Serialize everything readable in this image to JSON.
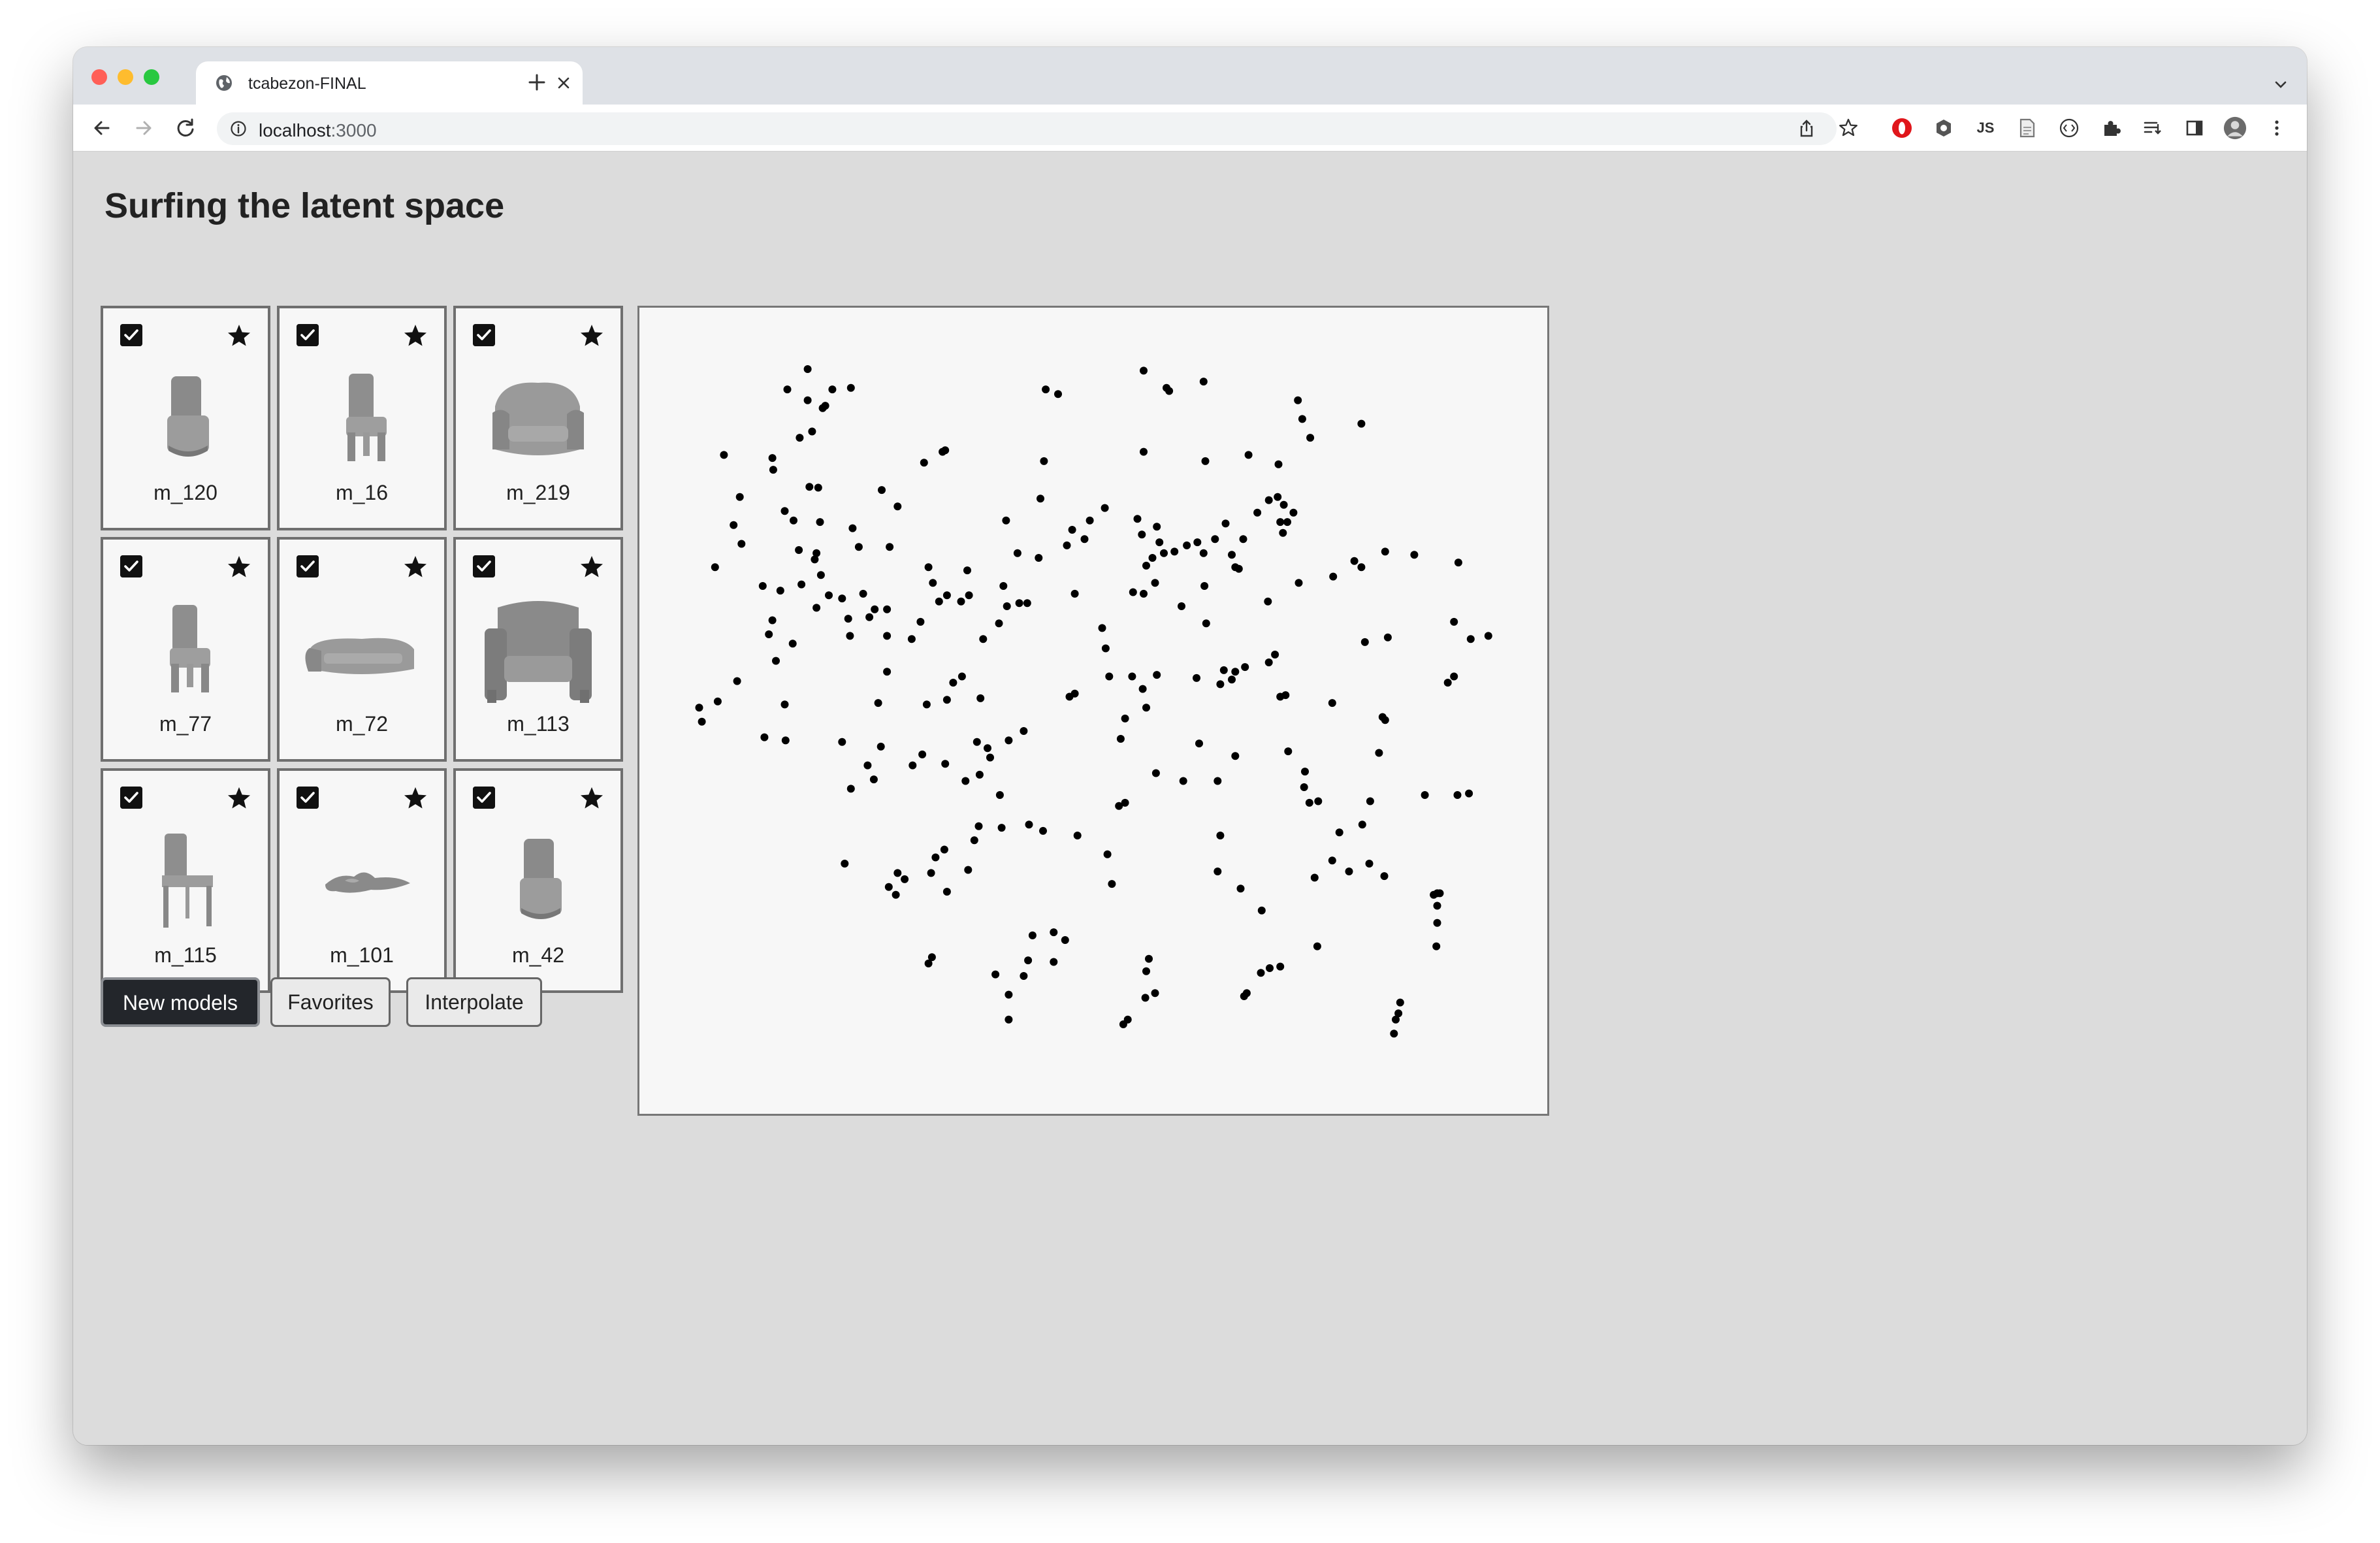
{
  "browser": {
    "tab_title": "tcabezon-FINAL",
    "url_host": "localhost",
    "url_port": ":3000",
    "traffic_colors": [
      "#ff5f57",
      "#febc2e",
      "#28c840"
    ],
    "toolbar_icons": [
      "share-icon",
      "bookmark-star-icon",
      "opera-icon",
      "shield-extension-icon",
      "js-extension-icon",
      "document-extension-icon",
      "code-extension-icon",
      "puzzle-extensions-icon",
      "reading-list-icon",
      "side-panel-icon",
      "profile-avatar",
      "more-menu-icon"
    ],
    "js_icon_text": "JS"
  },
  "page": {
    "title": "Surfing the latent space"
  },
  "models": [
    {
      "label": "m_120",
      "checked": true,
      "shape": "chair-solid"
    },
    {
      "label": "m_16",
      "checked": true,
      "shape": "chair-legs"
    },
    {
      "label": "m_219",
      "checked": true,
      "shape": "armchair-wide"
    },
    {
      "label": "m_77",
      "checked": true,
      "shape": "chair-legs"
    },
    {
      "label": "m_72",
      "checked": true,
      "shape": "sofa-low"
    },
    {
      "label": "m_113",
      "checked": true,
      "shape": "armchair-big"
    },
    {
      "label": "m_115",
      "checked": true,
      "shape": "chair-thin"
    },
    {
      "label": "m_101",
      "checked": true,
      "shape": "blob-flat"
    },
    {
      "label": "m_42",
      "checked": true,
      "shape": "chair-solid"
    }
  ],
  "buttons": {
    "new_models": "New models",
    "favorites": "Favorites",
    "interpolate": "Interpolate"
  },
  "chart_data": {
    "type": "scatter",
    "xlim": [
      0,
      100
    ],
    "ylim": [
      0,
      100
    ],
    "grid": false,
    "point_color": "#000000",
    "points": [
      [
        17.6,
        93.8
      ],
      [
        15.3,
        91.2
      ],
      [
        17.6,
        89.8
      ],
      [
        19.6,
        89.1
      ],
      [
        20.4,
        91.2
      ],
      [
        22.5,
        91.4
      ],
      [
        19.3,
        88.8
      ],
      [
        44.6,
        91.2
      ],
      [
        46.0,
        90.6
      ],
      [
        55.7,
        93.6
      ],
      [
        58.6,
        91.0
      ],
      [
        58.3,
        91.4
      ],
      [
        62.5,
        92.2
      ],
      [
        73.2,
        89.8
      ],
      [
        73.7,
        87.4
      ],
      [
        74.6,
        85.0
      ],
      [
        80.4,
        86.8
      ],
      [
        16.7,
        85.0
      ],
      [
        18.1,
        85.8
      ],
      [
        33.2,
        83.4
      ],
      [
        32.9,
        83.2
      ],
      [
        30.8,
        81.8
      ],
      [
        44.4,
        82.0
      ],
      [
        55.7,
        83.2
      ],
      [
        62.7,
        82.0
      ],
      [
        67.6,
        82.8
      ],
      [
        71.0,
        81.6
      ],
      [
        8.1,
        82.8
      ],
      [
        13.6,
        82.4
      ],
      [
        13.7,
        80.9
      ],
      [
        17.8,
        78.7
      ],
      [
        18.8,
        78.6
      ],
      [
        26.0,
        78.3
      ],
      [
        27.8,
        76.2
      ],
      [
        9.9,
        77.4
      ],
      [
        15.0,
        75.6
      ],
      [
        16.0,
        74.4
      ],
      [
        19.0,
        74.2
      ],
      [
        22.7,
        73.4
      ],
      [
        9.2,
        73.8
      ],
      [
        10.1,
        71.4
      ],
      [
        23.4,
        71.0
      ],
      [
        26.9,
        71.0
      ],
      [
        16.6,
        70.6
      ],
      [
        18.6,
        70.2
      ],
      [
        40.1,
        74.4
      ],
      [
        44.0,
        77.2
      ],
      [
        47.6,
        73.2
      ],
      [
        49.6,
        74.4
      ],
      [
        51.3,
        76.0
      ],
      [
        49.0,
        72.0
      ],
      [
        47.0,
        71.2
      ],
      [
        41.4,
        70.2
      ],
      [
        43.8,
        69.6
      ],
      [
        55.0,
        74.6
      ],
      [
        55.5,
        72.6
      ],
      [
        57.2,
        73.6
      ],
      [
        57.5,
        71.6
      ],
      [
        58.0,
        70.2
      ],
      [
        56.7,
        69.6
      ],
      [
        56.0,
        68.6
      ],
      [
        57.0,
        66.4
      ],
      [
        59.2,
        70.4
      ],
      [
        60.6,
        71.2
      ],
      [
        61.8,
        71.6
      ],
      [
        62.5,
        70.2
      ],
      [
        63.8,
        72.0
      ],
      [
        65.0,
        74.0
      ],
      [
        67.0,
        72.0
      ],
      [
        65.7,
        70.0
      ],
      [
        66.5,
        68.2
      ],
      [
        71.5,
        72.8
      ],
      [
        71.2,
        74.2
      ],
      [
        72.0,
        74.2
      ],
      [
        72.7,
        75.4
      ],
      [
        71.6,
        76.4
      ],
      [
        70.9,
        77.4
      ],
      [
        69.9,
        77.0
      ],
      [
        68.6,
        75.4
      ],
      [
        7.1,
        68.4
      ],
      [
        12.5,
        66.0
      ],
      [
        14.5,
        65.4
      ],
      [
        16.9,
        66.2
      ],
      [
        18.4,
        69.4
      ],
      [
        19.1,
        67.4
      ],
      [
        20.0,
        64.8
      ],
      [
        18.6,
        63.2
      ],
      [
        21.5,
        64.4
      ],
      [
        23.9,
        65.0
      ],
      [
        25.2,
        63.0
      ],
      [
        26.6,
        63.0
      ],
      [
        31.3,
        68.4
      ],
      [
        31.8,
        66.4
      ],
      [
        32.5,
        64.0
      ],
      [
        33.4,
        64.8
      ],
      [
        35.0,
        64.0
      ],
      [
        35.9,
        64.8
      ],
      [
        35.7,
        68.0
      ],
      [
        39.8,
        66.0
      ],
      [
        41.6,
        63.8
      ],
      [
        42.5,
        63.8
      ],
      [
        47.9,
        65.0
      ],
      [
        54.5,
        65.2
      ],
      [
        55.7,
        65.0
      ],
      [
        62.6,
        66.0
      ],
      [
        60.0,
        63.4
      ],
      [
        66.1,
        68.4
      ],
      [
        69.8,
        64.0
      ],
      [
        73.3,
        66.4
      ],
      [
        77.2,
        67.2
      ],
      [
        79.6,
        69.2
      ],
      [
        80.4,
        68.4
      ],
      [
        83.1,
        70.4
      ],
      [
        86.4,
        70.0
      ],
      [
        91.4,
        69.0
      ],
      [
        13.6,
        61.6
      ],
      [
        13.2,
        59.8
      ],
      [
        15.9,
        58.6
      ],
      [
        14.0,
        56.4
      ],
      [
        22.2,
        61.8
      ],
      [
        24.6,
        62.0
      ],
      [
        22.4,
        59.6
      ],
      [
        26.6,
        59.6
      ],
      [
        30.4,
        61.4
      ],
      [
        29.4,
        59.2
      ],
      [
        26.6,
        55.0
      ],
      [
        37.5,
        59.2
      ],
      [
        39.3,
        61.2
      ],
      [
        40.2,
        63.4
      ],
      [
        51.0,
        60.6
      ],
      [
        51.4,
        58.0
      ],
      [
        62.8,
        61.2
      ],
      [
        70.6,
        57.2
      ],
      [
        69.9,
        56.2
      ],
      [
        66.1,
        55.0
      ],
      [
        80.8,
        58.8
      ],
      [
        83.4,
        59.4
      ],
      [
        90.9,
        61.4
      ],
      [
        92.8,
        59.2
      ],
      [
        94.8,
        59.6
      ],
      [
        5.3,
        50.4
      ],
      [
        7.4,
        51.2
      ],
      [
        9.6,
        53.8
      ],
      [
        5.6,
        48.6
      ],
      [
        15.0,
        50.8
      ],
      [
        12.7,
        46.6
      ],
      [
        15.1,
        46.2
      ],
      [
        25.6,
        51.0
      ],
      [
        31.1,
        50.8
      ],
      [
        33.4,
        51.4
      ],
      [
        34.1,
        53.6
      ],
      [
        35.1,
        54.4
      ],
      [
        37.2,
        51.6
      ],
      [
        47.3,
        51.8
      ],
      [
        47.9,
        52.2
      ],
      [
        51.8,
        54.4
      ],
      [
        54.4,
        54.4
      ],
      [
        55.6,
        52.8
      ],
      [
        56.0,
        50.4
      ],
      [
        57.2,
        54.6
      ],
      [
        61.7,
        54.2
      ],
      [
        64.4,
        53.4
      ],
      [
        64.8,
        55.2
      ],
      [
        65.7,
        54.0
      ],
      [
        67.2,
        55.6
      ],
      [
        71.2,
        51.8
      ],
      [
        71.8,
        52.0
      ],
      [
        90.2,
        53.6
      ],
      [
        90.9,
        54.4
      ],
      [
        21.5,
        46.0
      ],
      [
        25.9,
        45.4
      ],
      [
        24.4,
        43.0
      ],
      [
        30.6,
        44.4
      ],
      [
        29.5,
        43.0
      ],
      [
        33.2,
        43.2
      ],
      [
        36.8,
        46.0
      ],
      [
        38.0,
        45.2
      ],
      [
        38.3,
        44.0
      ],
      [
        40.4,
        46.2
      ],
      [
        42.1,
        47.4
      ],
      [
        35.5,
        41.0
      ],
      [
        37.1,
        41.8
      ],
      [
        39.4,
        39.2
      ],
      [
        22.5,
        40.0
      ],
      [
        25.1,
        41.2
      ],
      [
        53.1,
        46.4
      ],
      [
        53.6,
        49.0
      ],
      [
        57.1,
        42.0
      ],
      [
        60.2,
        41.0
      ],
      [
        62.0,
        45.8
      ],
      [
        64.1,
        41.0
      ],
      [
        66.1,
        44.2
      ],
      [
        72.1,
        44.8
      ],
      [
        74.0,
        42.2
      ],
      [
        73.9,
        40.2
      ],
      [
        74.5,
        38.2
      ],
      [
        82.8,
        49.2
      ],
      [
        83.1,
        48.8
      ],
      [
        77.1,
        51.0
      ],
      [
        82.4,
        44.6
      ],
      [
        75.5,
        38.4
      ],
      [
        81.4,
        38.4
      ],
      [
        87.6,
        39.2
      ],
      [
        91.3,
        39.2
      ],
      [
        92.6,
        39.4
      ],
      [
        52.9,
        37.8
      ],
      [
        53.6,
        38.2
      ],
      [
        37.0,
        35.2
      ],
      [
        36.5,
        33.4
      ],
      [
        39.6,
        35.0
      ],
      [
        42.7,
        35.4
      ],
      [
        44.3,
        34.6
      ],
      [
        33.1,
        32.2
      ],
      [
        32.1,
        31.2
      ],
      [
        27.8,
        29.2
      ],
      [
        31.6,
        29.2
      ],
      [
        35.8,
        29.6
      ],
      [
        33.4,
        26.8
      ],
      [
        26.8,
        27.4
      ],
      [
        27.6,
        26.4
      ],
      [
        28.6,
        28.4
      ],
      [
        21.8,
        30.4
      ],
      [
        48.2,
        34.0
      ],
      [
        51.6,
        31.6
      ],
      [
        64.4,
        34.0
      ],
      [
        77.9,
        34.4
      ],
      [
        80.5,
        35.4
      ],
      [
        77.1,
        30.8
      ],
      [
        75.1,
        28.6
      ],
      [
        81.3,
        30.4
      ],
      [
        83.0,
        28.8
      ],
      [
        79.0,
        29.4
      ],
      [
        64.1,
        29.4
      ],
      [
        66.7,
        27.2
      ],
      [
        69.1,
        24.4
      ],
      [
        52.1,
        27.8
      ],
      [
        46.8,
        20.6
      ],
      [
        45.5,
        21.6
      ],
      [
        42.6,
        18.0
      ],
      [
        43.1,
        21.2
      ],
      [
        42.1,
        16.0
      ],
      [
        45.5,
        17.8
      ],
      [
        56.3,
        18.2
      ],
      [
        56.0,
        16.6
      ],
      [
        57.0,
        13.8
      ],
      [
        55.9,
        13.2
      ],
      [
        75.4,
        19.8
      ],
      [
        71.2,
        17.2
      ],
      [
        70.0,
        17.0
      ],
      [
        69.0,
        16.4
      ],
      [
        67.4,
        13.8
      ],
      [
        67.1,
        13.4
      ],
      [
        31.3,
        17.6
      ],
      [
        31.7,
        18.4
      ],
      [
        40.4,
        13.6
      ],
      [
        38.9,
        16.2
      ],
      [
        40.4,
        10.4
      ],
      [
        53.4,
        9.8
      ],
      [
        53.9,
        10.4
      ],
      [
        89.0,
        26.6
      ],
      [
        88.6,
        26.4
      ],
      [
        89.3,
        26.6
      ],
      [
        89.0,
        25.0
      ],
      [
        89.0,
        22.8
      ],
      [
        88.9,
        19.8
      ],
      [
        84.6,
        11.2
      ],
      [
        84.3,
        10.4
      ],
      [
        84.8,
        12.6
      ],
      [
        84.1,
        8.6
      ]
    ]
  }
}
